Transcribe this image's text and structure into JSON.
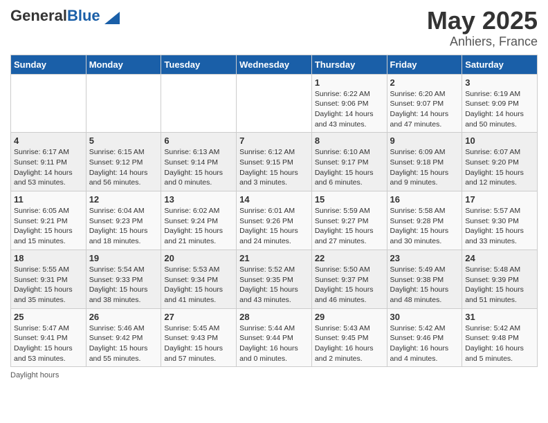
{
  "header": {
    "logo_general": "General",
    "logo_blue": "Blue",
    "title": "May 2025",
    "subtitle": "Anhiers, France"
  },
  "calendar": {
    "days_of_week": [
      "Sunday",
      "Monday",
      "Tuesday",
      "Wednesday",
      "Thursday",
      "Friday",
      "Saturday"
    ],
    "weeks": [
      [
        {
          "day": "",
          "info": ""
        },
        {
          "day": "",
          "info": ""
        },
        {
          "day": "",
          "info": ""
        },
        {
          "day": "",
          "info": ""
        },
        {
          "day": "1",
          "info": "Sunrise: 6:22 AM\nSunset: 9:06 PM\nDaylight: 14 hours and 43 minutes."
        },
        {
          "day": "2",
          "info": "Sunrise: 6:20 AM\nSunset: 9:07 PM\nDaylight: 14 hours and 47 minutes."
        },
        {
          "day": "3",
          "info": "Sunrise: 6:19 AM\nSunset: 9:09 PM\nDaylight: 14 hours and 50 minutes."
        }
      ],
      [
        {
          "day": "4",
          "info": "Sunrise: 6:17 AM\nSunset: 9:11 PM\nDaylight: 14 hours and 53 minutes."
        },
        {
          "day": "5",
          "info": "Sunrise: 6:15 AM\nSunset: 9:12 PM\nDaylight: 14 hours and 56 minutes."
        },
        {
          "day": "6",
          "info": "Sunrise: 6:13 AM\nSunset: 9:14 PM\nDaylight: 15 hours and 0 minutes."
        },
        {
          "day": "7",
          "info": "Sunrise: 6:12 AM\nSunset: 9:15 PM\nDaylight: 15 hours and 3 minutes."
        },
        {
          "day": "8",
          "info": "Sunrise: 6:10 AM\nSunset: 9:17 PM\nDaylight: 15 hours and 6 minutes."
        },
        {
          "day": "9",
          "info": "Sunrise: 6:09 AM\nSunset: 9:18 PM\nDaylight: 15 hours and 9 minutes."
        },
        {
          "day": "10",
          "info": "Sunrise: 6:07 AM\nSunset: 9:20 PM\nDaylight: 15 hours and 12 minutes."
        }
      ],
      [
        {
          "day": "11",
          "info": "Sunrise: 6:05 AM\nSunset: 9:21 PM\nDaylight: 15 hours and 15 minutes."
        },
        {
          "day": "12",
          "info": "Sunrise: 6:04 AM\nSunset: 9:23 PM\nDaylight: 15 hours and 18 minutes."
        },
        {
          "day": "13",
          "info": "Sunrise: 6:02 AM\nSunset: 9:24 PM\nDaylight: 15 hours and 21 minutes."
        },
        {
          "day": "14",
          "info": "Sunrise: 6:01 AM\nSunset: 9:26 PM\nDaylight: 15 hours and 24 minutes."
        },
        {
          "day": "15",
          "info": "Sunrise: 5:59 AM\nSunset: 9:27 PM\nDaylight: 15 hours and 27 minutes."
        },
        {
          "day": "16",
          "info": "Sunrise: 5:58 AM\nSunset: 9:28 PM\nDaylight: 15 hours and 30 minutes."
        },
        {
          "day": "17",
          "info": "Sunrise: 5:57 AM\nSunset: 9:30 PM\nDaylight: 15 hours and 33 minutes."
        }
      ],
      [
        {
          "day": "18",
          "info": "Sunrise: 5:55 AM\nSunset: 9:31 PM\nDaylight: 15 hours and 35 minutes."
        },
        {
          "day": "19",
          "info": "Sunrise: 5:54 AM\nSunset: 9:33 PM\nDaylight: 15 hours and 38 minutes."
        },
        {
          "day": "20",
          "info": "Sunrise: 5:53 AM\nSunset: 9:34 PM\nDaylight: 15 hours and 41 minutes."
        },
        {
          "day": "21",
          "info": "Sunrise: 5:52 AM\nSunset: 9:35 PM\nDaylight: 15 hours and 43 minutes."
        },
        {
          "day": "22",
          "info": "Sunrise: 5:50 AM\nSunset: 9:37 PM\nDaylight: 15 hours and 46 minutes."
        },
        {
          "day": "23",
          "info": "Sunrise: 5:49 AM\nSunset: 9:38 PM\nDaylight: 15 hours and 48 minutes."
        },
        {
          "day": "24",
          "info": "Sunrise: 5:48 AM\nSunset: 9:39 PM\nDaylight: 15 hours and 51 minutes."
        }
      ],
      [
        {
          "day": "25",
          "info": "Sunrise: 5:47 AM\nSunset: 9:41 PM\nDaylight: 15 hours and 53 minutes."
        },
        {
          "day": "26",
          "info": "Sunrise: 5:46 AM\nSunset: 9:42 PM\nDaylight: 15 hours and 55 minutes."
        },
        {
          "day": "27",
          "info": "Sunrise: 5:45 AM\nSunset: 9:43 PM\nDaylight: 15 hours and 57 minutes."
        },
        {
          "day": "28",
          "info": "Sunrise: 5:44 AM\nSunset: 9:44 PM\nDaylight: 16 hours and 0 minutes."
        },
        {
          "day": "29",
          "info": "Sunrise: 5:43 AM\nSunset: 9:45 PM\nDaylight: 16 hours and 2 minutes."
        },
        {
          "day": "30",
          "info": "Sunrise: 5:42 AM\nSunset: 9:46 PM\nDaylight: 16 hours and 4 minutes."
        },
        {
          "day": "31",
          "info": "Sunrise: 5:42 AM\nSunset: 9:48 PM\nDaylight: 16 hours and 5 minutes."
        }
      ]
    ]
  },
  "footer": {
    "daylight_hours": "Daylight hours"
  }
}
